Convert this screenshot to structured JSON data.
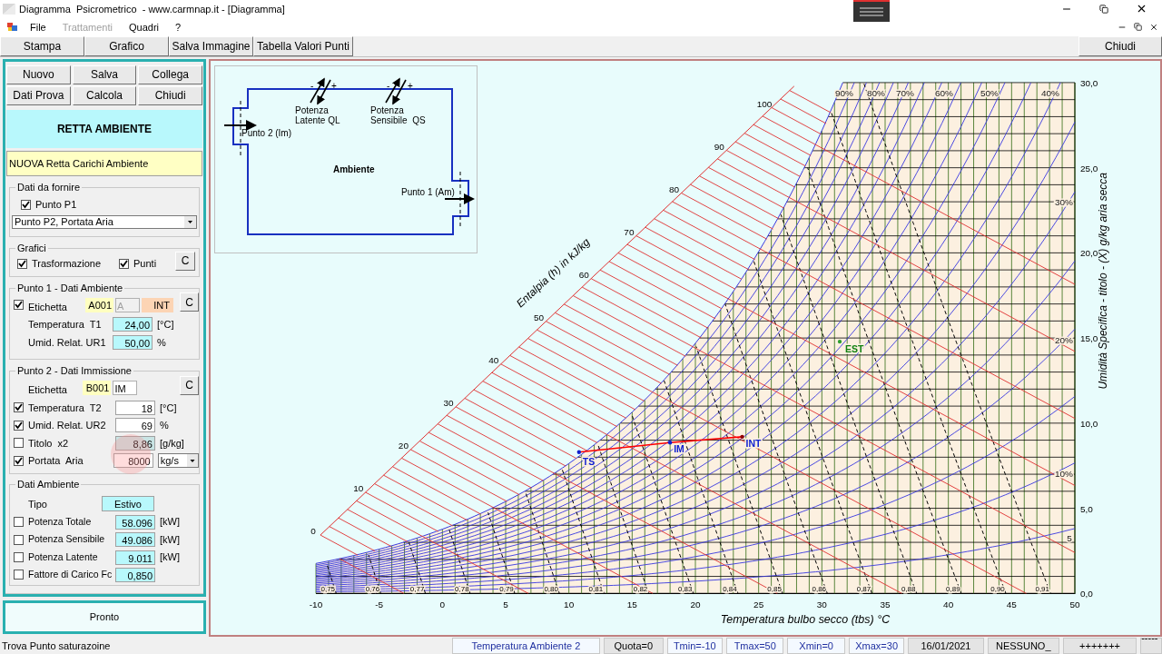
{
  "window": {
    "title": "Diagramma  Psicrometrico  - www.carmnap.it - [Diagramma]"
  },
  "menu": [
    {
      "label": "File",
      "disabled": false
    },
    {
      "label": "Trattamenti",
      "disabled": true
    },
    {
      "label": "Quadri",
      "disabled": false
    },
    {
      "label": "?",
      "disabled": false
    }
  ],
  "toolbar": {
    "buttons": [
      "Stampa",
      "Grafico",
      "Salva Immagine",
      "Tabella Valori Punti"
    ],
    "close": "Chiudi"
  },
  "panel": {
    "buttons": [
      "Nuovo",
      "Salva",
      "Collega",
      "Dati Prova",
      "Calcola",
      "Chiudi"
    ],
    "header": "RETTA AMBIENTE",
    "note": "NUOVA Retta Carichi Ambiente",
    "input_group": {
      "title": "Dati da fornire",
      "checkbox": {
        "label": "Punto P1",
        "checked": true
      },
      "dropdown": "Punto P2, Portata Aria"
    },
    "charts_group": {
      "title": "Grafici",
      "checkboxes": [
        {
          "label": "Trasformazione",
          "checked": true
        },
        {
          "label": "Punti",
          "checked": true
        }
      ],
      "button": "C"
    },
    "point1": {
      "title": "Punto 1 - Dati Ambiente",
      "button": "C",
      "label_row": {
        "label": "Etichetta",
        "checked": true,
        "code": "A001",
        "letter": "A",
        "tag": "INT"
      },
      "rows": [
        {
          "label": "Temperatura  T1",
          "value": "24,00",
          "unit": "[°C]"
        },
        {
          "label": "Umid. Relat. UR1",
          "value": "50,00",
          "unit": "%"
        }
      ]
    },
    "point2": {
      "title": "Punto 2 - Dati Immissione",
      "button": "C",
      "label_row": {
        "label": "Etichetta",
        "code": "B001",
        "tag": "IM"
      },
      "rows": [
        {
          "kind": "input",
          "checked": true,
          "label": "Temperatura  T2",
          "value": "18",
          "unit": "[°C]"
        },
        {
          "kind": "input",
          "checked": true,
          "label": "Umid. Relat. UR2",
          "value": "69",
          "unit": "%"
        },
        {
          "kind": "computed",
          "checked": false,
          "label": "Titolo  x2",
          "value": "8,86",
          "unit": "[g/kg]"
        },
        {
          "kind": "select",
          "checked": true,
          "label": "Portata  Aria",
          "value": "8000",
          "unit": "kg/s"
        }
      ]
    },
    "environment": {
      "title": "Dati Ambiente",
      "type_label": "Tipo",
      "type_value": "Estivo",
      "rows": [
        {
          "checked": false,
          "label": "Potenza Totale",
          "value": "58.096",
          "unit": "[kW]"
        },
        {
          "checked": false,
          "label": "Potenza Sensibile",
          "value": "49.086",
          "unit": "[kW]"
        },
        {
          "checked": false,
          "label": "Potenza Latente",
          "value": "9.011",
          "unit": "[kW]"
        },
        {
          "checked": false,
          "label": "Fattore di Carico Fc",
          "value": "0,850"
        }
      ]
    },
    "status": "Pronto"
  },
  "diagram": {
    "latent": "Potenza\nLatente QL",
    "sensible": "Potenza\nSensibile  QS",
    "inlet": "Punto 2 (Im)",
    "room": "Ambiente",
    "outlet": "Punto 1 (Am)",
    "signs": [
      "-",
      "+",
      "-",
      "+"
    ]
  },
  "chart": {
    "enthalpy_title": "Entalpia (h) in kJ/kg",
    "enthalpy_labels": [
      "0",
      "10",
      "20",
      "30",
      "40",
      "50",
      "60",
      "70",
      "80",
      "90",
      "100"
    ],
    "rh_labels": [
      "90%",
      "80%",
      "70%",
      "60%",
      "50%",
      "40%",
      "30%",
      "20%",
      "10%",
      "5"
    ],
    "volume_labels": [
      "0,75",
      "0,76",
      "0,77",
      "0,78",
      "0,79",
      "0,80",
      "0,81",
      "0,82",
      "0,83",
      "0,84",
      "0,85",
      "0,86",
      "0,87",
      "0,88",
      "0,89",
      "0,90",
      "0,91"
    ],
    "chart_data": {
      "type": "line",
      "xlabel": "Temperatura bulbo secco (tbs) °C",
      "ylabel": "Umidità Specifica - titolo - (X) g/kg aria secca",
      "x": [
        10.8,
        18.0,
        23.7
      ],
      "series": [
        {
          "color": "#ff0000",
          "values": [
            8.3,
            8.86,
            9.2
          ]
        }
      ],
      "xlim": [
        -10,
        50
      ],
      "ylim": [
        0,
        30
      ],
      "xticks": [
        -10,
        -5,
        0,
        5,
        10,
        15,
        20,
        25,
        30,
        35,
        40,
        45,
        50
      ],
      "yticks": [
        {
          "value": 0,
          "label": "0,0"
        },
        {
          "value": 5,
          "label": "5,0"
        },
        {
          "value": 10,
          "label": "10,0"
        },
        {
          "value": 15,
          "label": "15,0"
        },
        {
          "value": 20,
          "label": "20,0"
        },
        {
          "value": 25,
          "label": "25,0"
        },
        {
          "value": 30,
          "label": "30,0"
        }
      ],
      "annotations": [
        {
          "text": "TS",
          "x": 10.8,
          "y": 8.3
        },
        {
          "text": "IM",
          "x": 18.0,
          "y": 8.86
        },
        {
          "text": "INT",
          "x": 23.7,
          "y": 9.2
        },
        "EST"
      ],
      "grid": true
    }
  },
  "status_bar": {
    "message": "Trova Punto saturazoine",
    "panels": [
      {
        "text": "Temperatura Ambiente 2",
        "highlighted": true
      },
      {
        "text": "Quota=0",
        "highlighted": false
      },
      {
        "text": "Tmin=-10",
        "highlighted": true
      },
      {
        "text": "Tmax=50",
        "highlighted": true
      },
      {
        "text": "Xmin=0",
        "highlighted": true
      },
      {
        "text": "Xmax=30",
        "highlighted": true
      },
      {
        "text": "16/01/2021",
        "highlighted": false
      },
      {
        "text": "NESSUNO_",
        "highlighted": false
      },
      {
        "text": "+++++++",
        "highlighted": false
      },
      {
        "text": "------",
        "highlighted": false
      }
    ]
  }
}
